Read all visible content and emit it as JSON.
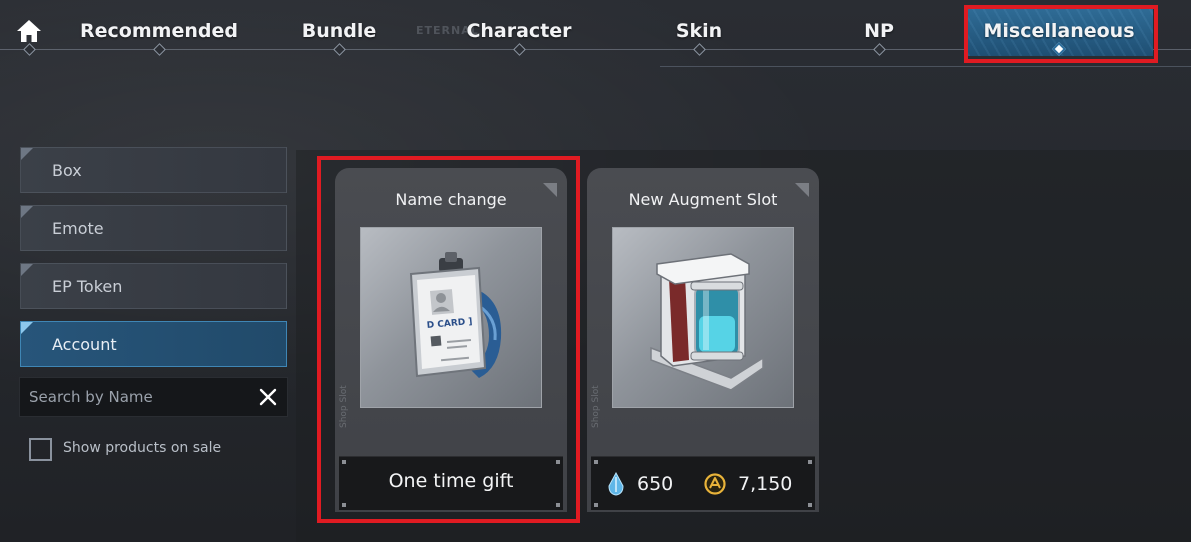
{
  "nav": {
    "home_icon": "home-icon",
    "watermark": "ETERNAL",
    "tabs": [
      {
        "label": "Recommended"
      },
      {
        "label": "Bundle"
      },
      {
        "label": "Character"
      },
      {
        "label": "Skin"
      },
      {
        "label": "NP"
      },
      {
        "label": "Miscellaneous",
        "active": true
      }
    ]
  },
  "sidebar": {
    "items": [
      {
        "label": "Box"
      },
      {
        "label": "Emote"
      },
      {
        "label": "EP Token"
      },
      {
        "label": "Account",
        "active": true
      }
    ],
    "search": {
      "placeholder": "Search by Name",
      "value": ""
    },
    "sale_filter": {
      "label": "Show products on sale",
      "checked": false
    }
  },
  "products": [
    {
      "title": "Name change",
      "image_icon": "id-card-icon",
      "side_text": "Shop Slot",
      "footer": "One time gift"
    },
    {
      "title": "New Augment Slot",
      "image_icon": "augment-capsule-icon",
      "side_text": "Shop Slot",
      "prices": [
        {
          "currency_icon": "crystal-currency-icon",
          "amount": "650"
        },
        {
          "currency_icon": "gold-coin-currency-icon",
          "amount": "7,150"
        }
      ]
    }
  ],
  "colors": {
    "highlight": "#e01b22",
    "active_tab": "#2f6c96",
    "active_side": "#27557a",
    "crystal": "#5fb6e8",
    "gold": "#e8b33a"
  }
}
